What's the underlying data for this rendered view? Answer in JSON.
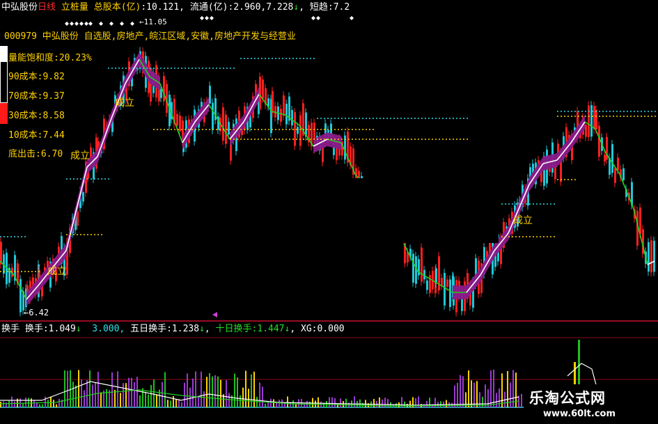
{
  "header": {
    "stock_name": "中弘股份",
    "period": "日线",
    "indicator": "立桩量",
    "total_label": "总股本(亿)",
    "total_value": ":10.121,",
    "float_label": "流通(亿)",
    "float_value": ":2.960,7.228",
    "short_label": "短趋:",
    "short_value": "7.2",
    "marker": "←11.05"
  },
  "info": {
    "code": "000979",
    "name": "中弘股份",
    "tags": "自选股,房地产,皖江区域,安徽,房地产开发与经营业"
  },
  "cost": [
    {
      "label": "量能饱和度",
      "value": ":20.23%"
    },
    {
      "label": "90成本",
      "value": ":9.82"
    },
    {
      "label": "70成本",
      "value": ":9.37"
    },
    {
      "label": "30成本",
      "value": ":8.58"
    },
    {
      "label": "10成本",
      "value": ":7.44"
    },
    {
      "label": "底出击",
      "value": ":6.70"
    }
  ],
  "low_marker": "←6.42",
  "signal_label": "成立",
  "volume_legend": {
    "l1": "换手",
    "l2": "换手:",
    "v1": "1.049",
    "v2": "3.000,",
    "l3": "五日换手:",
    "v3": "1.238",
    "l4": "十日换手:",
    "v4": "1.447",
    "l5": "XG:",
    "v5": "0.000"
  },
  "watermark": {
    "title": "乐淘公式网",
    "url": "www.60lt.com"
  },
  "colors": {
    "up": "#ff2020",
    "down": "#20c8d8",
    "yellow": "#ffd200",
    "purple": "#8a1a8a",
    "cyan_dotted": "#33d8e8"
  }
}
